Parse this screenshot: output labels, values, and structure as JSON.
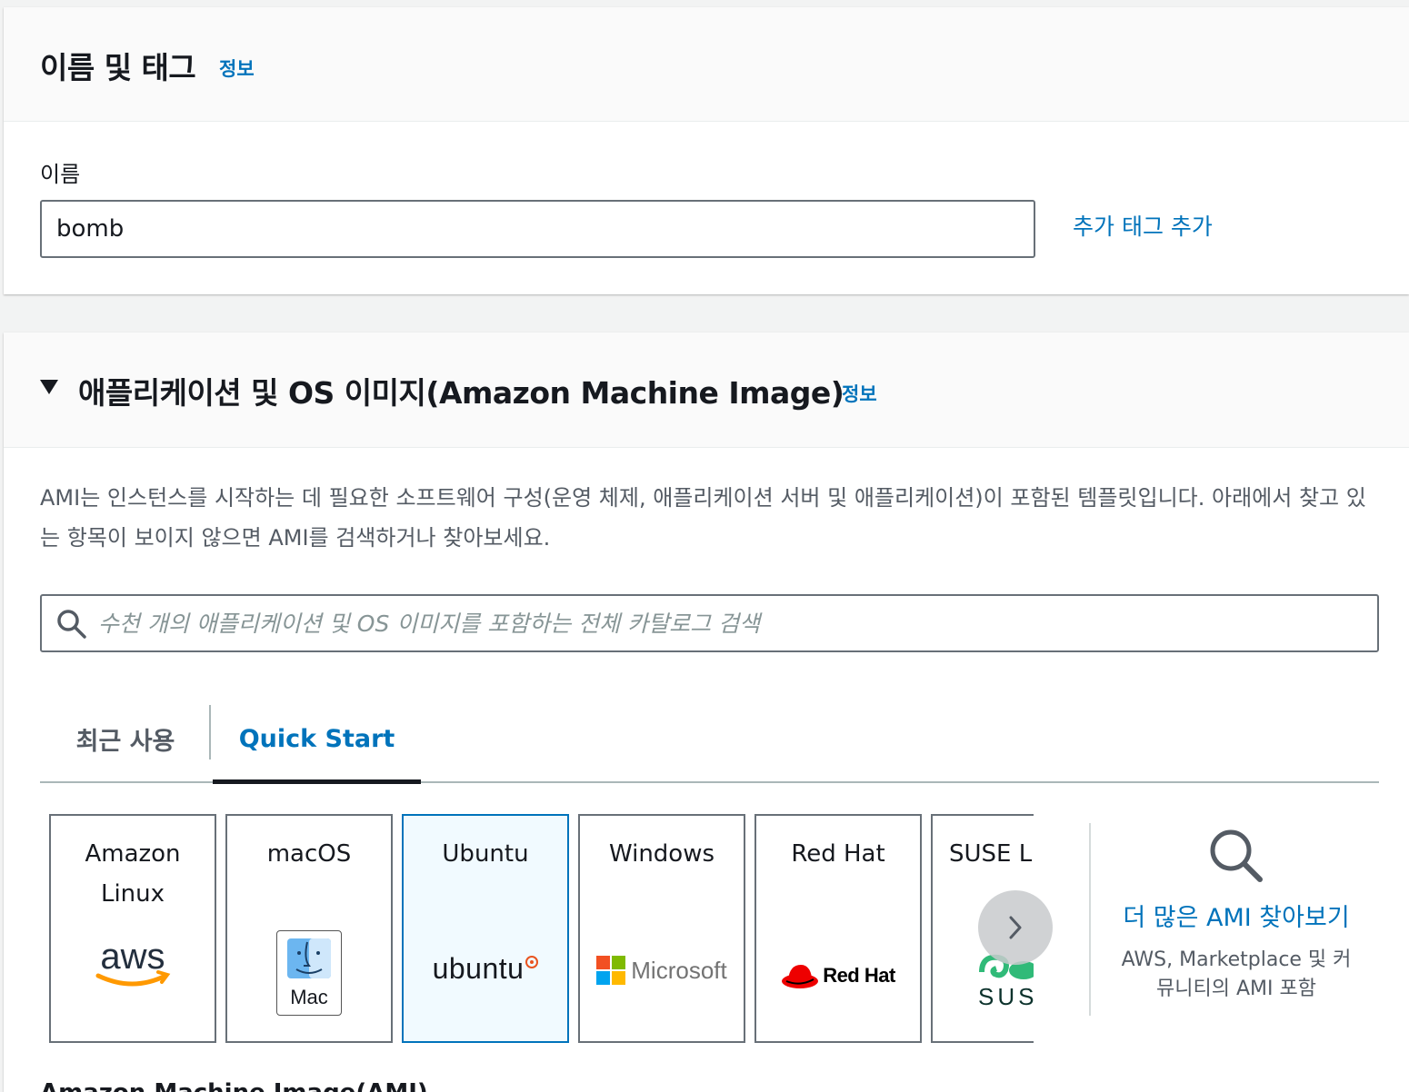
{
  "name_tags": {
    "title": "이름 및 태그",
    "info_link": "정보",
    "name_label": "이름",
    "name_value": "bomb",
    "add_tags_link": "추가 태그 추가"
  },
  "ami": {
    "title": "애플리케이션 및 OS 이미지(Amazon Machine Image)",
    "info_link": "정보",
    "description": "AMI는 인스턴스를 시작하는 데 필요한 소프트웨어 구성(운영 체제, 애플리케이션 서버 및 애플리케이션)이 포함된 템플릿입니다. 아래에서 찾고 있는 항목이 보이지 않으면 AMI를 검색하거나 찾아보세요.",
    "search_placeholder": "수천 개의 애플리케이션 및 OS 이미지를 포함하는 전체 카탈로그 검색",
    "tabs": [
      {
        "label": "최근 사용",
        "active": false
      },
      {
        "label": "Quick Start",
        "active": true
      }
    ],
    "tiles": [
      {
        "label": "Amazon Linux",
        "logo": "aws",
        "selected": false
      },
      {
        "label": "macOS",
        "logo": "Mac",
        "selected": false
      },
      {
        "label": "Ubuntu",
        "logo": "ubuntu",
        "selected": true
      },
      {
        "label": "Windows",
        "logo": "Microsoft",
        "selected": false
      },
      {
        "label": "Red Hat",
        "logo": "Red Hat",
        "selected": false
      },
      {
        "label": "SUSE Li",
        "logo": "SUS",
        "selected": false
      }
    ],
    "browse_more": {
      "title": "더 많은 AMI 찾아보기",
      "subtitle": "AWS, Marketplace 및 커뮤니티의 AMI 포함"
    },
    "next_section_title": "Amazon Machine Image(AMI)"
  },
  "colors": {
    "link": "#0073bb",
    "selected_bg": "#f1faff",
    "border": "#687078"
  }
}
